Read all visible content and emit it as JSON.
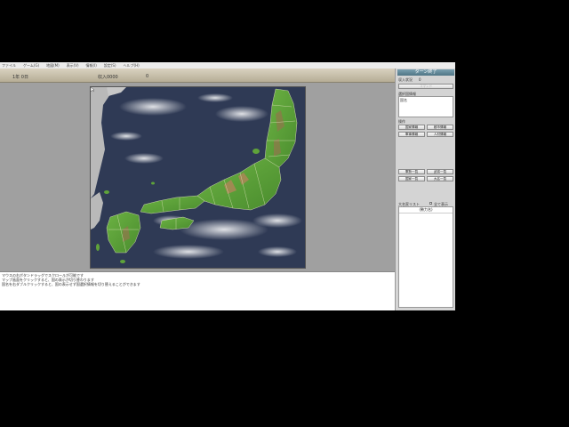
{
  "menu": [
    "ファイル",
    "ゲーム(G)",
    "地図(M)",
    "表示(V)",
    "情報(I)",
    "設定(S)",
    "ヘルプ(H)"
  ],
  "infobar": {
    "left": "1年 0日",
    "mid": "収入0000",
    "right": "0"
  },
  "panel": {
    "title": "ターン終了",
    "field_label": "収入状況",
    "field_value": "0",
    "top_button": "コマンド",
    "section_label": "選択国情報",
    "info_value": "国名",
    "group_label": "操作",
    "buttons_row1": [
      "国家情報",
      "都市情報"
    ],
    "buttons_row2": [
      "軍事情報",
      "人材情報"
    ],
    "buttons_row3": [
      "軍勢一覧",
      "武将一覧"
    ],
    "buttons_row4": [
      "国家一覧",
      "大名一覧"
    ],
    "list_label": "大名家リスト",
    "checkbox_label": "全て表示",
    "list_header": "(勢力名)"
  },
  "log": [
    "マウスの右ボタンドラッグでスクロールが可能です",
    "マップ画面をクリックすると、国の表示が切り替わります",
    "国名を右ダブルクリックすると、国の表示せず国選択情報を切り替えることができます"
  ],
  "colors": {
    "sea": "#2f3a55",
    "land": "#5fa33a",
    "mountain": "#a08a52",
    "border": "#e8e8c8"
  }
}
